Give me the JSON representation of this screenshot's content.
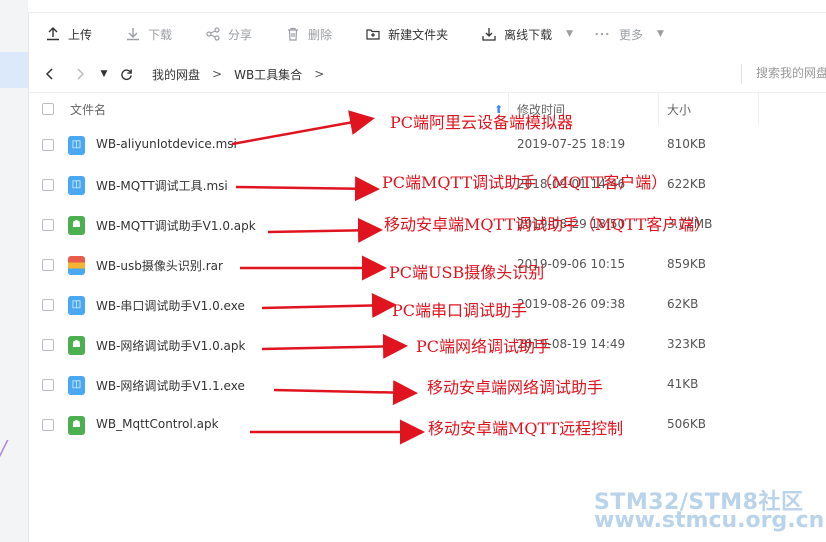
{
  "toolbar": {
    "upload": "上传",
    "download": "下载",
    "share": "分享",
    "delete": "删除",
    "new_folder": "新建文件夹",
    "offline_download": "离线下载",
    "more": "更多"
  },
  "nav": {
    "breadcrumb": [
      "我的网盘",
      "WB工具集合"
    ],
    "search_placeholder": "搜索我的网盘"
  },
  "table": {
    "headers": {
      "name": "文件名",
      "time": "修改时间",
      "size": "大小"
    },
    "rows": [
      {
        "name": "WB-aliyunIotdevice.msi",
        "time": "2019-07-25 18:19",
        "size": "810KB",
        "type": "msi"
      },
      {
        "name": "WB-MQTT调试工具.msi",
        "time": "2018-09-01 14:46",
        "size": "622KB",
        "type": "msi"
      },
      {
        "name": "WB-MQTT调试助手V1.0.apk",
        "time": "2019-08-29 18:50",
        "size": "3.72MB",
        "type": "apk"
      },
      {
        "name": "WB-usb摄像头识别.rar",
        "time": "2019-09-06 10:15",
        "size": "859KB",
        "type": "rar"
      },
      {
        "name": "WB-串口调试助手V1.0.exe",
        "time": "2019-08-26 09:38",
        "size": "62KB",
        "type": "exe"
      },
      {
        "name": "WB-网络调试助手V1.0.apk",
        "time": "2019-08-19 14:49",
        "size": "323KB",
        "type": "apk"
      },
      {
        "name": "WB-网络调试助手V1.1.exe",
        "time": "",
        "size": "41KB",
        "type": "exe"
      },
      {
        "name": "WB_MqttControl.apk",
        "time": "",
        "size": "506KB",
        "type": "apk"
      }
    ]
  },
  "annotations": [
    "PC端阿里云设备端模拟器",
    "PC端MQTT调试助手（MQTT客户端）",
    "移动安卓端MQTT调试助手（MQTT客户端）",
    "PC端USB摄像头识别",
    "PC端串口调试助手",
    "PC端网络调试助手",
    "移动安卓端网络调试助手",
    "移动安卓端MQTT远程控制"
  ],
  "watermark": {
    "line1": "STM32/STM8社区",
    "line2": "www.stmcu.org.cn"
  },
  "colors": {
    "accent_blue": "#3b8cf5",
    "annotation_red": "#e0141e",
    "watermark": "#b8d3ea"
  }
}
